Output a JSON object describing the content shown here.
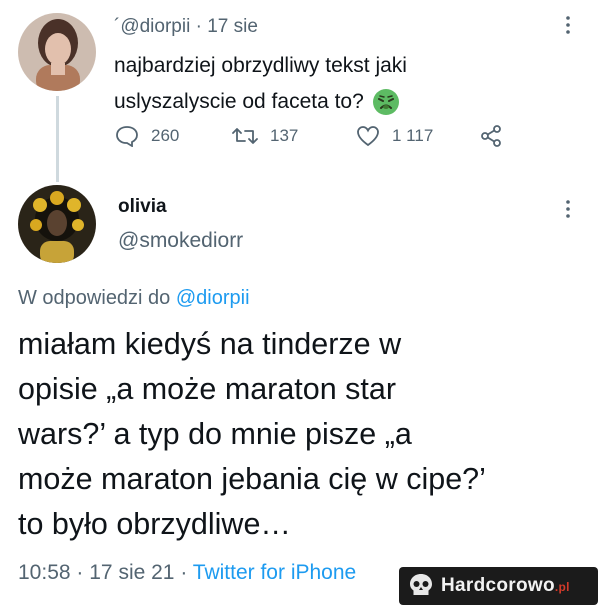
{
  "tweet1": {
    "handle": "´@diorpii",
    "separator": "·",
    "date": "17 sie",
    "text_line1": "najbardziej obrzydliwy tekst jaki",
    "text_line2": "uslyszalyscie od faceta to?",
    "emoji_icon": "nauseated-face-emoji",
    "actions": {
      "replies": "260",
      "retweets": "137",
      "likes": "1 117"
    }
  },
  "tweet2": {
    "display_name": "olivia",
    "handle": "@smokediorr",
    "reply_to_prefix": "W odpowiedzi do",
    "reply_to_handle": "@diorpii",
    "text_lines": [
      "miałam kiedyś na tinderze w",
      "opisie „a może maraton star",
      "wars?’ a typ do mnie pisze „a",
      "może maraton jebania cię w cipe?’",
      "to było obrzydliwe…"
    ],
    "meta_time": "10:58",
    "meta_sep1": "·",
    "meta_date": "17 sie 21",
    "meta_sep2": "·",
    "meta_source": "Twitter for iPhone"
  },
  "watermark": {
    "text": "Hardcorowo",
    "suffix": ".pl"
  },
  "colors": {
    "text": "#0f1419",
    "muted": "#536471",
    "link": "#1d9bf0",
    "thread_line": "#cfd9de"
  }
}
